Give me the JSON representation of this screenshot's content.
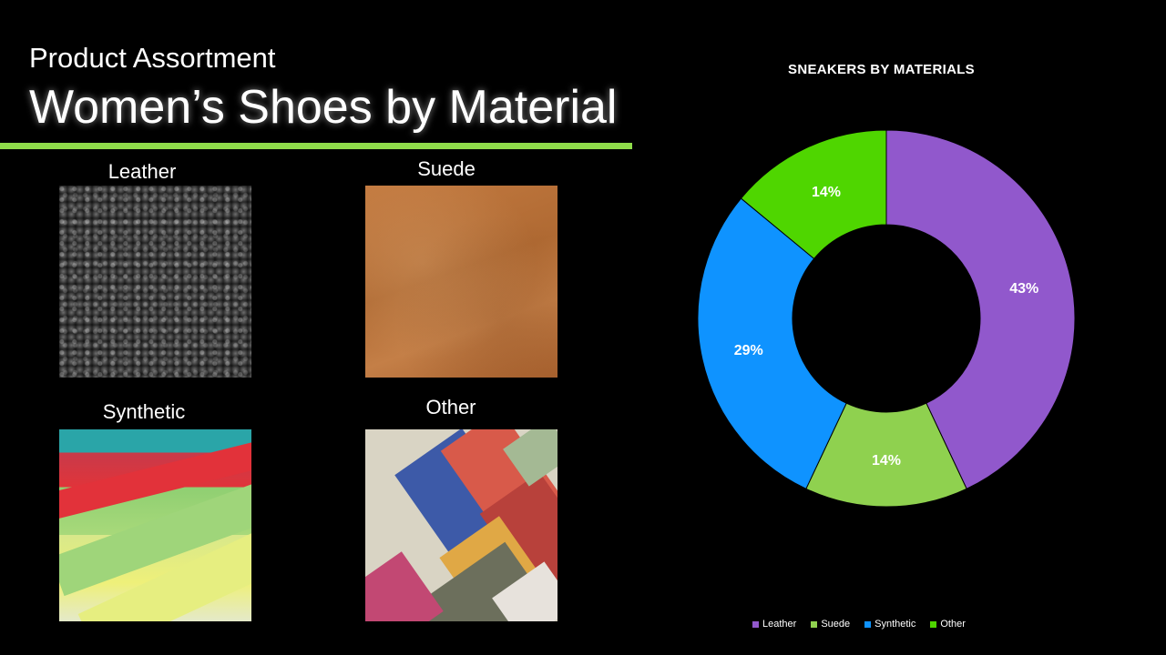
{
  "header": {
    "subtitle": "Product Assortment",
    "title": "Women’s Shoes by Material",
    "accent_color": "#8fdc4a"
  },
  "swatches": [
    {
      "label": "Leather",
      "texture": "leather-texture"
    },
    {
      "label": "Suede",
      "texture": "suede-texture"
    },
    {
      "label": "Synthetic",
      "texture": "synthetic-fabric-texture"
    },
    {
      "label": "Other",
      "texture": "fabric-samples-texture"
    }
  ],
  "chart_data": {
    "type": "pie",
    "donut": true,
    "title": "SNEAKERS BY MATERIALS",
    "categories": [
      "Leather",
      "Suede",
      "Synthetic",
      "Other"
    ],
    "values": [
      43,
      14,
      29,
      14
    ],
    "data_labels": [
      "43%",
      "14%",
      "29%",
      "14%"
    ],
    "colors": [
      "#9158cc",
      "#8fd14f",
      "#0f93ff",
      "#4fd600"
    ],
    "legend_position": "bottom"
  }
}
